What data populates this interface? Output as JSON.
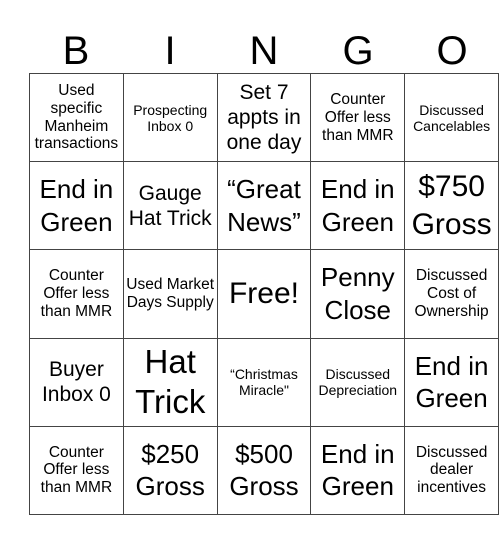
{
  "title_letters": [
    "B",
    "I",
    "N",
    "G",
    "O"
  ],
  "cells": [
    [
      "Used specific Manheim transactions",
      "Prospecting Inbox 0",
      "Set 7 appts in one day",
      "Counter Offer less than MMR",
      "Discussed Cancelables"
    ],
    [
      "End in Green",
      "Gauge Hat Trick",
      "“Great News”",
      "End in Green",
      "$750 Gross"
    ],
    [
      "Counter Offer less than MMR",
      "Used Market Days Supply",
      "Free!",
      "Penny Close",
      "Discussed Cost of Ownership"
    ],
    [
      "Buyer Inbox 0",
      "Hat Trick",
      "“Christmas Miracle\"",
      "Discussed Depreciation",
      "End in Green"
    ],
    [
      "Counter Offer less than MMR",
      "$250 Gross",
      "$500 Gross",
      "End in Green",
      "Discussed dealer incentives"
    ]
  ]
}
